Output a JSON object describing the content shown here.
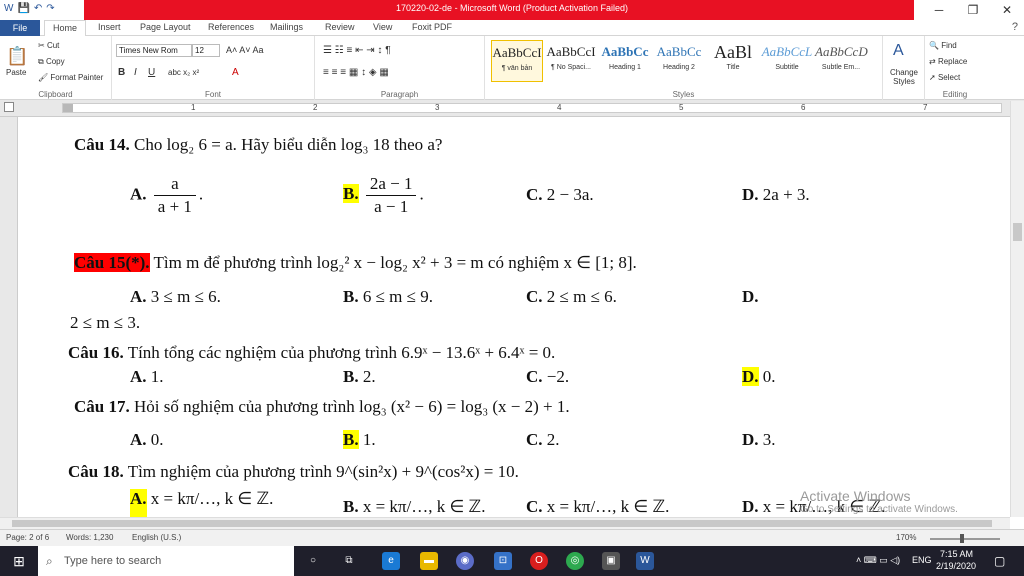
{
  "window": {
    "title": "170220-02-de - Microsoft Word (Product Activation Failed)"
  },
  "tabs": {
    "file": "File",
    "items": [
      "Home",
      "Insert",
      "Page Layout",
      "References",
      "Mailings",
      "Review",
      "View",
      "Foxit PDF"
    ]
  },
  "ribbon": {
    "clipboard": {
      "paste": "Paste",
      "cut": "Cut",
      "copy": "Copy",
      "format_painter": "Format Painter",
      "label": "Clipboard"
    },
    "font": {
      "name": "Times New Rom",
      "size": "12",
      "label": "Font"
    },
    "paragraph": {
      "label": "Paragraph"
    },
    "styles": {
      "label": "Styles",
      "items": [
        {
          "sample": "AaBbCcI",
          "name": "¶ vān bản"
        },
        {
          "sample": "AaBbCcI",
          "name": "¶ No Spaci..."
        },
        {
          "sample": "AaBbCc",
          "name": "Heading 1"
        },
        {
          "sample": "AaBbCc",
          "name": "Heading 2"
        },
        {
          "sample": "AaBl",
          "name": "Title"
        },
        {
          "sample": "AaBbCcL",
          "name": "Subtitle"
        },
        {
          "sample": "AaBbCcD",
          "name": "Subtle Em..."
        }
      ],
      "change": "Change Styles"
    },
    "editing": {
      "find": "Find",
      "replace": "Replace",
      "select": "Select",
      "label": "Editing"
    }
  },
  "ruler": {
    "numbers": [
      "1",
      "2",
      "3",
      "4",
      "5",
      "6",
      "7"
    ]
  },
  "document": {
    "q14": {
      "label": "Câu 14.",
      "text": "Cho",
      "math": "log₂ 6 = a. Hãy biểu diễn log₃ 18 theo a?",
      "a": "A.",
      "a_num": "a",
      "a_den": "a + 1",
      "b": "B.",
      "b_num": "2a − 1",
      "b_den": "a − 1",
      "c": "C.",
      "c_val": "2 − 3a.",
      "d": "D.",
      "d_val": "2a + 3."
    },
    "q15": {
      "label": "Câu 15(*).",
      "text": "Tìm m để phương trình log₂² x − log₂ x² + 3 = m có nghiệm x ∈ [1; 8].",
      "a": "A.",
      "a_val": "3 ≤ m ≤ 6.",
      "b": "B.",
      "b_val": "6 ≤ m ≤ 9.",
      "c": "C.",
      "c_val": "2 ≤ m ≤ 6.",
      "d": "D.",
      "d_val": "2 ≤ m ≤ 3."
    },
    "q16": {
      "label": "Câu 16.",
      "text": "Tính tổng các nghiệm của phương trình 6.9ˣ − 13.6ˣ + 6.4ˣ = 0.",
      "a": "A.",
      "a_val": "1.",
      "b": "B.",
      "b_val": "2.",
      "c": "C.",
      "c_val": "−2.",
      "d": "D.",
      "d_val": "0."
    },
    "q17": {
      "label": "Câu 17.",
      "text": "Hỏi số nghiệm của phương trình log₃ (x² − 6) = log₃ (x − 2) + 1.",
      "a": "A.",
      "a_val": "0.",
      "b": "B.",
      "b_val": "1.",
      "c": "C.",
      "c_val": "2.",
      "d": "D.",
      "d_val": "3."
    },
    "q18": {
      "label": "Câu 18.",
      "text": "Tìm nghiệm của phương trình 9^(sin²x) + 9^(cos²x) = 10.",
      "a": "A.",
      "a_val": "x = kπ/…, k ∈ ℤ.",
      "b": "B.",
      "b_val": "x = kπ/…, k ∈ ℤ.",
      "c": "C.",
      "c_val": "x = kπ/…, k ∈ ℤ.",
      "d": "D.",
      "d_val": "x = kπ/…, k ∈ ℤ."
    }
  },
  "watermark": {
    "line1": "Activate Windows",
    "line2": "Go to Settings to activate Windows."
  },
  "status": {
    "page": "Page: 2 of 6",
    "words": "Words: 1,230",
    "language": "English (U.S.)",
    "zoom": "170%"
  },
  "taskbar": {
    "search_placeholder": "Type here to search",
    "time": "7:15 AM",
    "date": "2/19/2020",
    "lang": "ENG"
  },
  "colors": {
    "title_bar": "#e81123",
    "file_tab": "#2b579a",
    "highlight_yellow": "#ffff00",
    "highlight_red": "#ff0000",
    "taskbar": "#1f1f2b"
  }
}
